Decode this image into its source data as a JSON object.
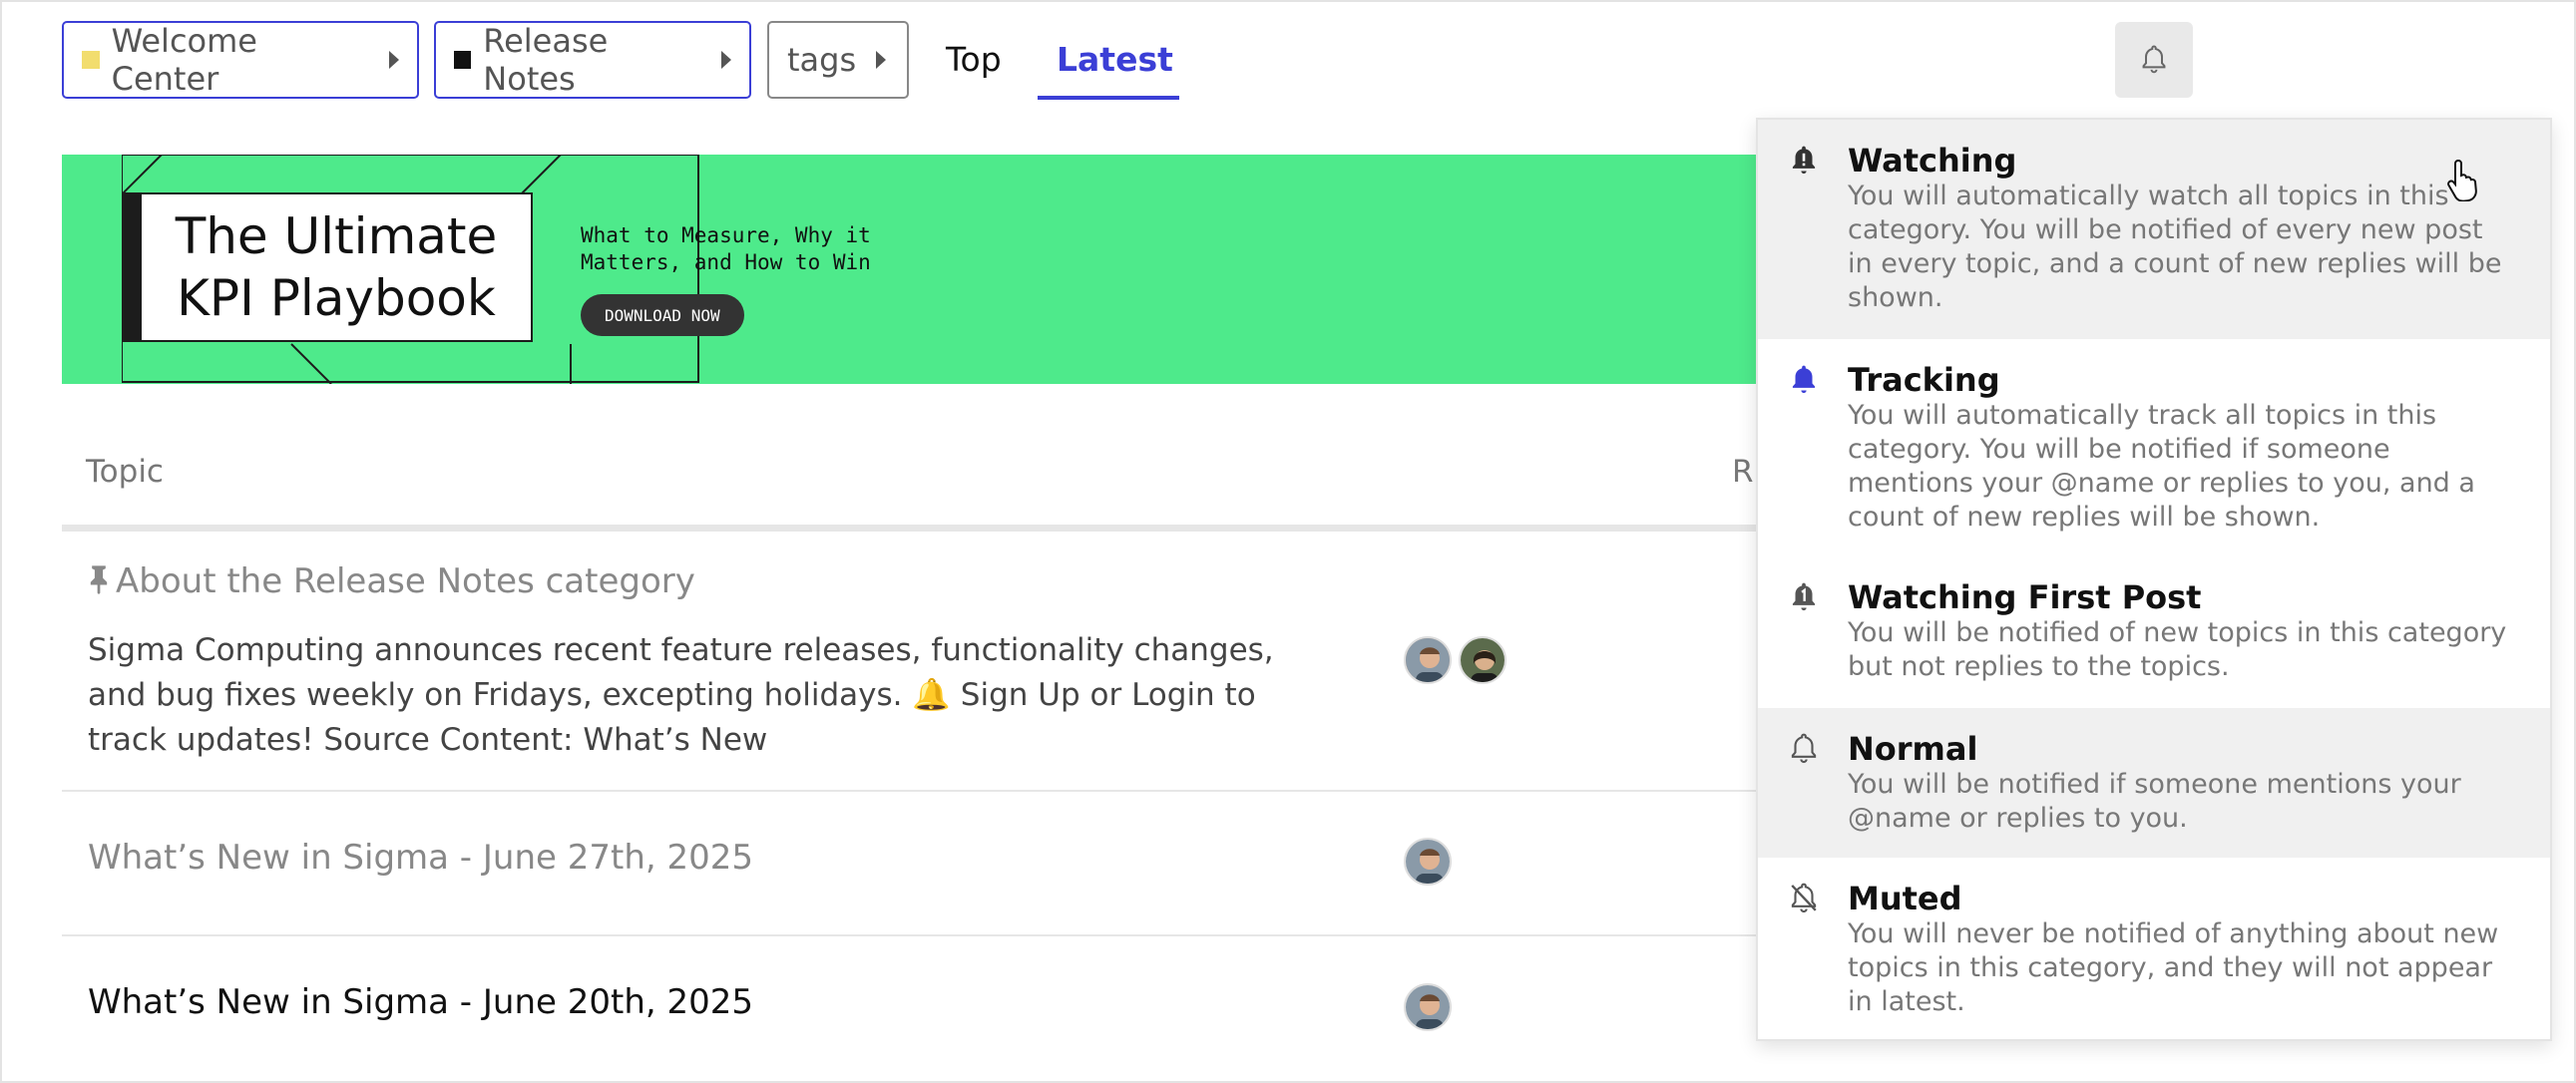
{
  "nav": {
    "breadcrumbs": [
      {
        "label": "Welcome Center",
        "color": "#f2dd6e"
      },
      {
        "label": "Release Notes",
        "color": "#111111"
      },
      {
        "label": "tags"
      }
    ],
    "links": [
      {
        "label": "Top"
      },
      {
        "label": "Latest",
        "active": true
      }
    ],
    "notification_icon": "bell-icon"
  },
  "banner": {
    "title": "The Ultimate KPI Playbook",
    "tagline": "What to Measure, Why it Matters, and How to Win",
    "button": "DOWNLOAD NOW",
    "bg_color": "#4eea8b"
  },
  "table": {
    "headers": {
      "topic": "Topic",
      "replies_partial": "R"
    },
    "rows": [
      {
        "title": "About the Release Notes category",
        "pinned": true,
        "excerpt": "Sigma Computing announces recent feature releases, functionality changes, and bug fixes weekly on Fridays, excepting holidays. 🔔 Sign Up or Login to track updates! Source Content: What’s New",
        "posters": 2
      },
      {
        "title": "What’s New in Sigma - June 27th, 2025",
        "posters": 1
      },
      {
        "title": "What’s New in Sigma - June 20th, 2025",
        "posters": 1
      }
    ]
  },
  "menu": {
    "options": [
      {
        "icon": "bell-exclamation-icon",
        "title": "Watching",
        "desc": "You will automatically watch all topics in this category. You will be notified of every new post in every topic, and a count of new replies will be shown."
      },
      {
        "icon": "bell-icon",
        "title": "Tracking",
        "desc": "You will automatically track all topics in this category. You will be notified if someone mentions your @name or replies to you, and a count of new replies will be shown.",
        "icon_color": "#3b3fd6"
      },
      {
        "icon": "bell-one-icon",
        "title": "Watching First Post",
        "desc": "You will be notified of new topics in this category but not replies to the topics."
      },
      {
        "icon": "bell-outline-icon",
        "title": "Normal",
        "desc": "You will be notified if someone mentions your @name or replies to you."
      },
      {
        "icon": "bell-slash-icon",
        "title": "Muted",
        "desc": "You will never be notified of anything about new topics in this category, and they will not appear in latest."
      }
    ]
  }
}
